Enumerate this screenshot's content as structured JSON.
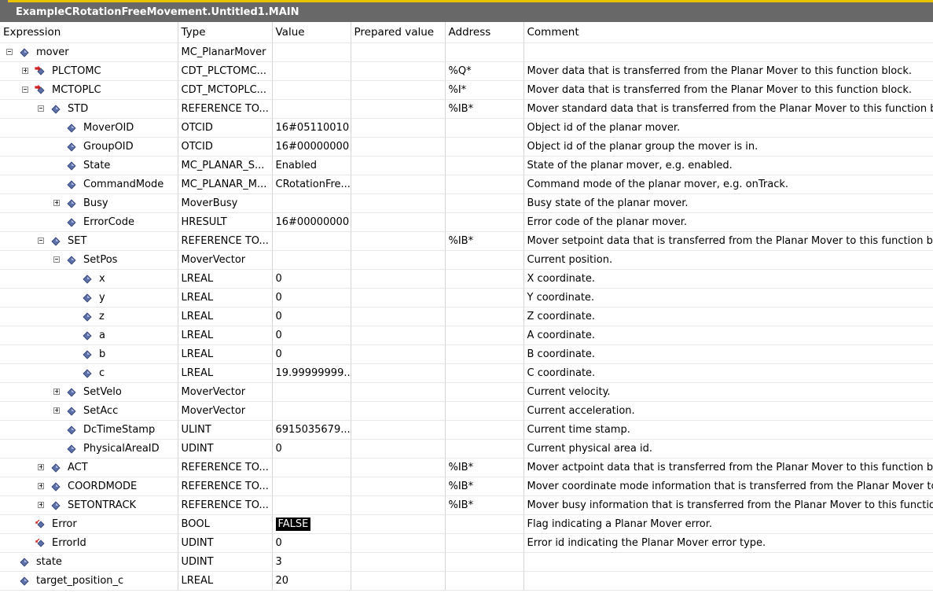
{
  "window": {
    "title": "ExampleCRotationFreeMovement.Untitled1.MAIN"
  },
  "columns": [
    "Expression",
    "Type",
    "Value",
    "Prepared value",
    "Address",
    "Comment"
  ],
  "rows": [
    {
      "depth": 0,
      "exp": "collapse",
      "icon": "diamond",
      "name": "mover",
      "type": "MC_PlanarMover",
      "value": "",
      "prepared": "",
      "address": "",
      "comment": ""
    },
    {
      "depth": 1,
      "exp": "expand",
      "icon": "output",
      "name": "PLCTOMC",
      "type": "CDT_PLCTOMC...",
      "value": "",
      "prepared": "",
      "address": "%Q*",
      "comment": "Mover data that is transferred from the Planar Mover to this function block."
    },
    {
      "depth": 1,
      "exp": "collapse",
      "icon": "output",
      "name": "MCTOPLC",
      "type": "CDT_MCTOPLC...",
      "value": "",
      "prepared": "",
      "address": "%I*",
      "comment": "Mover data that is transferred from the Planar Mover to this function block."
    },
    {
      "depth": 2,
      "exp": "collapse",
      "icon": "diamond",
      "name": "STD",
      "type": "REFERENCE TO...",
      "value": "",
      "prepared": "",
      "address": "%IB*",
      "comment": "Mover standard data that is transferred from the Planar Mover to this function b"
    },
    {
      "depth": 3,
      "exp": "none",
      "icon": "diamond",
      "name": "MoverOID",
      "type": "OTCID",
      "value": "16#05110010",
      "prepared": "",
      "address": "",
      "comment": "Object id of the planar mover."
    },
    {
      "depth": 3,
      "exp": "none",
      "icon": "diamond",
      "name": "GroupOID",
      "type": "OTCID",
      "value": "16#00000000",
      "prepared": "",
      "address": "",
      "comment": "Object id of the planar group the mover is in."
    },
    {
      "depth": 3,
      "exp": "none",
      "icon": "diamond",
      "name": "State",
      "type": "MC_PLANAR_S...",
      "value": "Enabled",
      "prepared": "",
      "address": "",
      "comment": "State of the planar mover, e.g. enabled."
    },
    {
      "depth": 3,
      "exp": "none",
      "icon": "diamond",
      "name": "CommandMode",
      "type": "MC_PLANAR_M...",
      "value": "CRotationFre...",
      "prepared": "",
      "address": "",
      "comment": "Command mode of the planar mover, e.g. onTrack."
    },
    {
      "depth": 3,
      "exp": "expand",
      "icon": "diamond",
      "name": "Busy",
      "type": "MoverBusy",
      "value": "",
      "prepared": "",
      "address": "",
      "comment": "Busy state of the planar mover."
    },
    {
      "depth": 3,
      "exp": "none",
      "icon": "diamond",
      "name": "ErrorCode",
      "type": "HRESULT",
      "value": "16#00000000",
      "prepared": "",
      "address": "",
      "comment": "Error code of the planar mover."
    },
    {
      "depth": 2,
      "exp": "collapse",
      "icon": "diamond",
      "name": "SET",
      "type": "REFERENCE TO...",
      "value": "",
      "prepared": "",
      "address": "%IB*",
      "comment": "Mover setpoint data that is transferred from the Planar Mover to this function b"
    },
    {
      "depth": 3,
      "exp": "collapse",
      "icon": "diamond",
      "name": "SetPos",
      "type": "MoverVector",
      "value": "",
      "prepared": "",
      "address": "",
      "comment": "Current position."
    },
    {
      "depth": 4,
      "exp": "none",
      "icon": "diamond",
      "name": "x",
      "type": "LREAL",
      "value": "0",
      "prepared": "",
      "address": "",
      "comment": "X coordinate."
    },
    {
      "depth": 4,
      "exp": "none",
      "icon": "diamond",
      "name": "y",
      "type": "LREAL",
      "value": "0",
      "prepared": "",
      "address": "",
      "comment": "Y coordinate."
    },
    {
      "depth": 4,
      "exp": "none",
      "icon": "diamond",
      "name": "z",
      "type": "LREAL",
      "value": "0",
      "prepared": "",
      "address": "",
      "comment": "Z coordinate."
    },
    {
      "depth": 4,
      "exp": "none",
      "icon": "diamond",
      "name": "a",
      "type": "LREAL",
      "value": "0",
      "prepared": "",
      "address": "",
      "comment": "A coordinate."
    },
    {
      "depth": 4,
      "exp": "none",
      "icon": "diamond",
      "name": "b",
      "type": "LREAL",
      "value": "0",
      "prepared": "",
      "address": "",
      "comment": "B coordinate."
    },
    {
      "depth": 4,
      "exp": "none",
      "icon": "diamond",
      "name": "c",
      "type": "LREAL",
      "value": "19.99999999...",
      "prepared": "",
      "address": "",
      "comment": "C coordinate."
    },
    {
      "depth": 3,
      "exp": "expand",
      "icon": "diamond",
      "name": "SetVelo",
      "type": "MoverVector",
      "value": "",
      "prepared": "",
      "address": "",
      "comment": "Current velocity."
    },
    {
      "depth": 3,
      "exp": "expand",
      "icon": "diamond",
      "name": "SetAcc",
      "type": "MoverVector",
      "value": "",
      "prepared": "",
      "address": "",
      "comment": "Current acceleration."
    },
    {
      "depth": 3,
      "exp": "none",
      "icon": "diamond",
      "name": "DcTimeStamp",
      "type": "ULINT",
      "value": "6915035679...",
      "prepared": "",
      "address": "",
      "comment": "Current time stamp."
    },
    {
      "depth": 3,
      "exp": "none",
      "icon": "diamond",
      "name": "PhysicalAreaID",
      "type": "UDINT",
      "value": "0",
      "prepared": "",
      "address": "",
      "comment": "Current physical area id."
    },
    {
      "depth": 2,
      "exp": "expand",
      "icon": "diamond",
      "name": "ACT",
      "type": "REFERENCE TO...",
      "value": "",
      "prepared": "",
      "address": "%IB*",
      "comment": "Mover actpoint data that is transferred from the Planar Mover to this function b"
    },
    {
      "depth": 2,
      "exp": "expand",
      "icon": "diamond",
      "name": "COORDMODE",
      "type": "REFERENCE TO...",
      "value": "",
      "prepared": "",
      "address": "%IB*",
      "comment": "Mover coordinate mode information that is transferred from the Planar Mover to t"
    },
    {
      "depth": 2,
      "exp": "expand",
      "icon": "diamond",
      "name": "SETONTRACK",
      "type": "REFERENCE TO...",
      "value": "",
      "prepared": "",
      "address": "%IB*",
      "comment": "Mover busy information that is transferred from the Planar Mover to this functio"
    },
    {
      "depth": 1,
      "exp": "none",
      "icon": "input",
      "name": "Error",
      "type": "BOOL",
      "value": "FALSE",
      "highlight": true,
      "prepared": "",
      "address": "",
      "comment": "Flag indicating a Planar Mover error."
    },
    {
      "depth": 1,
      "exp": "none",
      "icon": "input",
      "name": "ErrorId",
      "type": "UDINT",
      "value": "0",
      "prepared": "",
      "address": "",
      "comment": "Error id indicating the Planar Mover error type."
    },
    {
      "depth": 0,
      "exp": "none",
      "icon": "diamond",
      "name": "state",
      "type": "UDINT",
      "value": "3",
      "prepared": "",
      "address": "",
      "comment": ""
    },
    {
      "depth": 0,
      "exp": "none",
      "icon": "diamond",
      "name": "target_position_c",
      "type": "LREAL",
      "value": "20",
      "prepared": "",
      "address": "",
      "comment": ""
    }
  ]
}
